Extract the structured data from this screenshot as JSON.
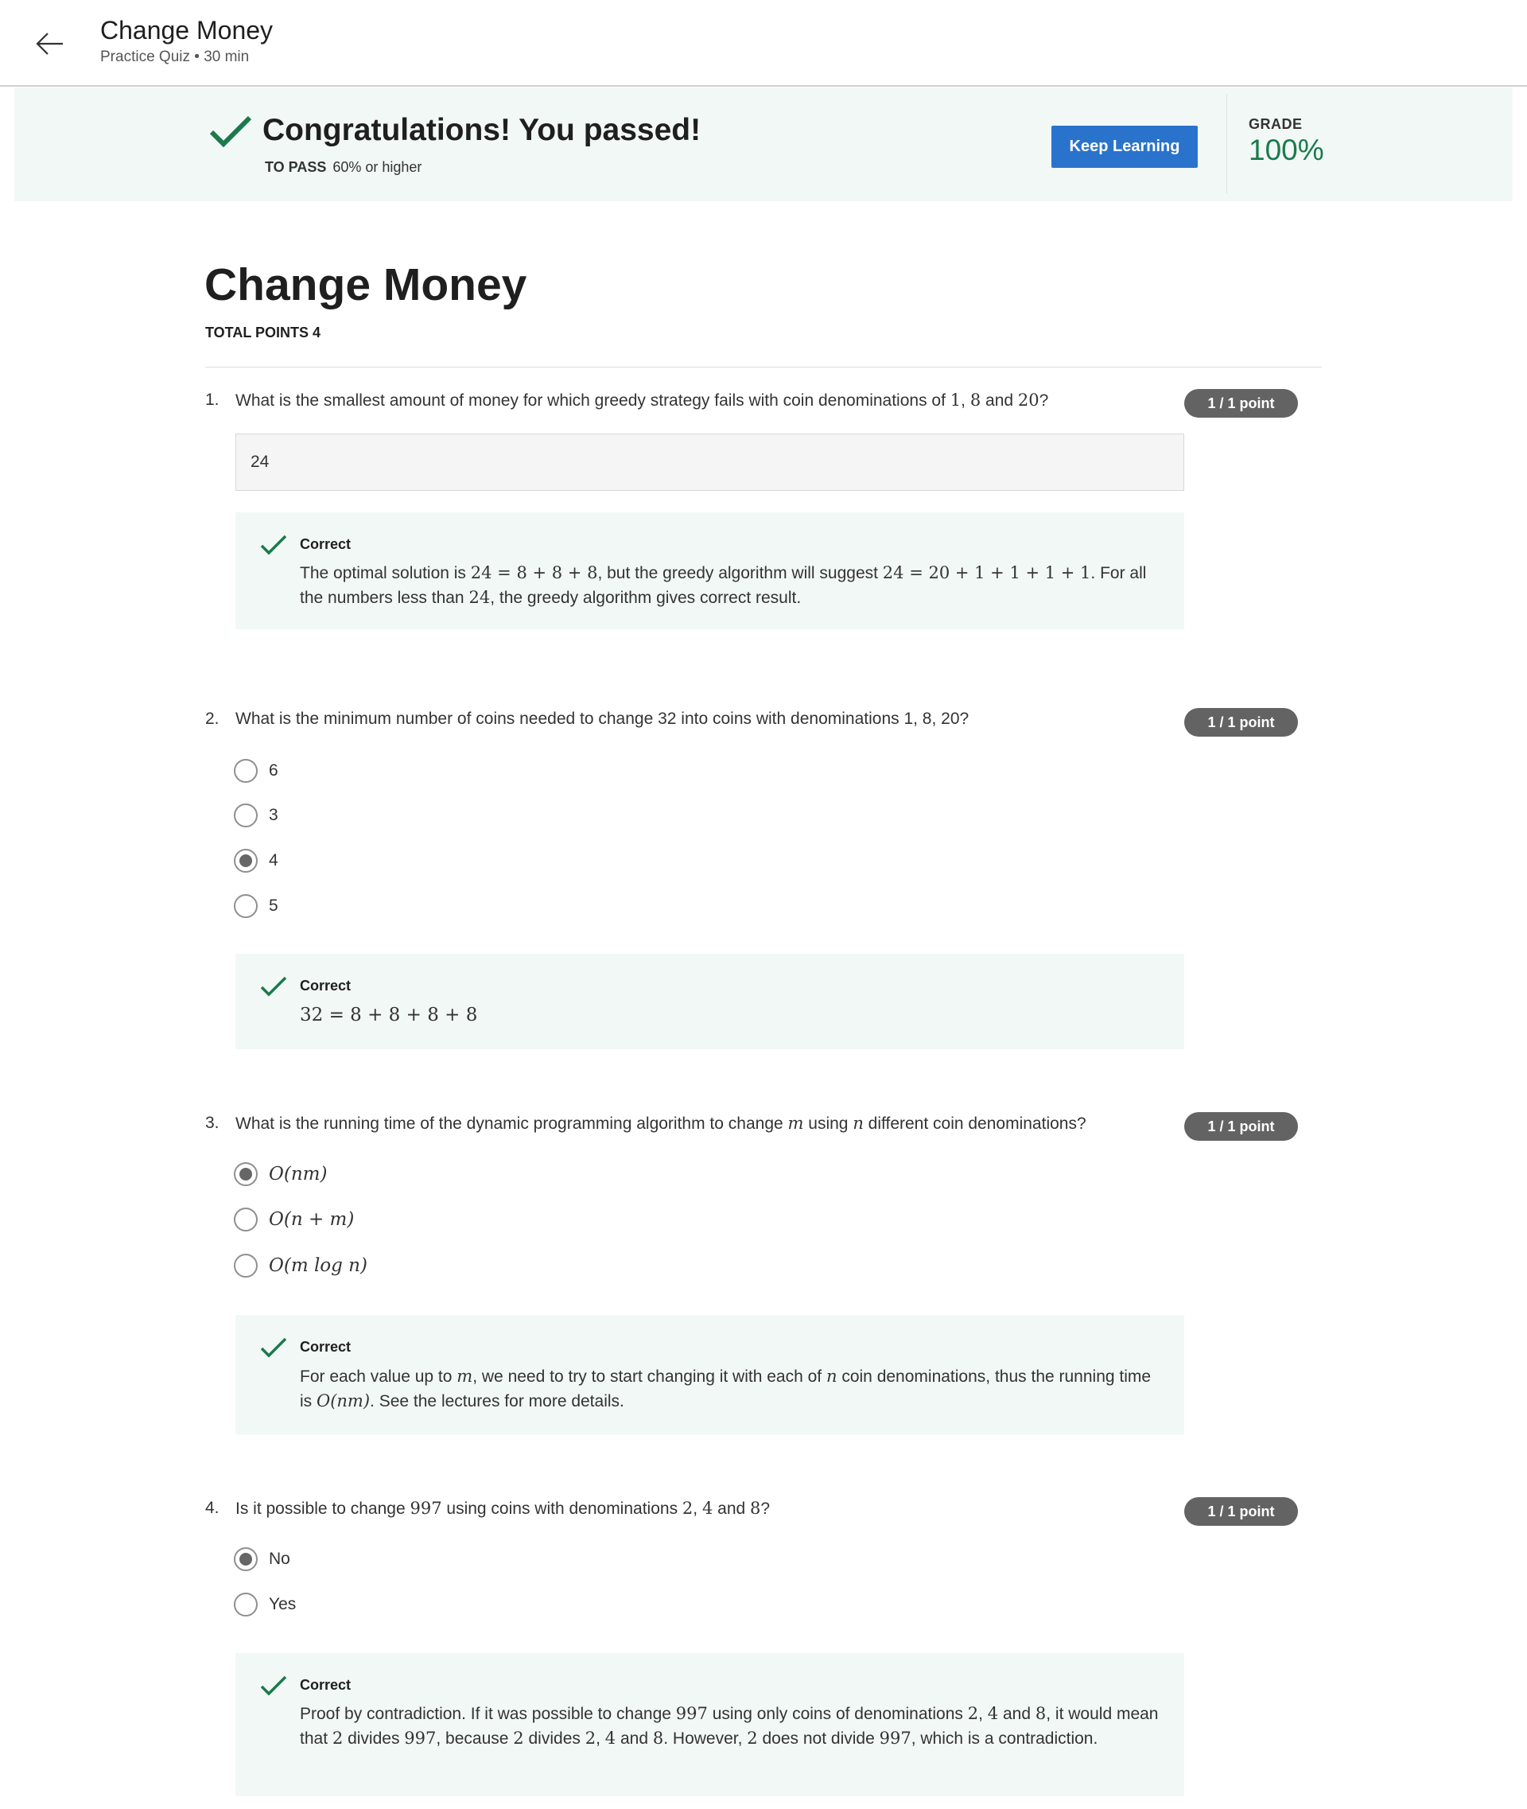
{
  "header": {
    "title": "Change Money",
    "subtitle": "Practice Quiz • 30 min"
  },
  "banner": {
    "title": "Congratulations! You passed!",
    "to_pass_label": "TO PASS",
    "to_pass_value": "60% or higher",
    "keep_learning": "Keep Learning",
    "grade_label": "GRADE",
    "grade_value": "100%"
  },
  "quiz": {
    "title": "Change Money",
    "total_points": "TOTAL POINTS 4"
  },
  "colors": {
    "accent": "#2a73cc",
    "success": "#1b7a4c",
    "badge": "#636363",
    "feedback_bg": "#f2f8f6"
  },
  "questions": [
    {
      "num": "1.",
      "points": "1 / 1 point",
      "text_before": "What is the smallest amount of money for which greedy strategy fails with coin denominations of ",
      "m1": "1",
      "sep1": ", ",
      "m2": "8",
      "sep2": " and ",
      "m3": "20",
      "text_after": "?",
      "answer": "24",
      "feedback_label": "Correct",
      "fb_t1": "The optimal solution is ",
      "fb_m1": "24 = 8 + 8 + 8",
      "fb_t2": ", but the greedy algorithm will suggest ",
      "fb_m2": "24 = 20 + 1 + 1 + 1 + 1",
      "fb_t3": ". For all the numbers less than ",
      "fb_m3": "24",
      "fb_t4": ", the greedy algorithm gives correct result."
    },
    {
      "num": "2.",
      "points": "1 / 1 point",
      "text": "What is the minimum number of coins needed to change 32 into coins with denominations 1, 8, 20?",
      "options": [
        "6",
        "3",
        "4",
        "5"
      ],
      "selected": "4",
      "feedback_label": "Correct",
      "fb_math": "32 = 8 + 8 + 8 + 8"
    },
    {
      "num": "3.",
      "points": "1 / 1 point",
      "text_before": "What is the running time of the dynamic programming algorithm to change ",
      "m1": "m",
      "text_mid": " using ",
      "m2": "n",
      "text_after": " different coin denominations?",
      "options": [
        "O(nm)",
        "O(n + m)",
        "O(m log n)"
      ],
      "selected": "O(nm)",
      "feedback_label": "Correct",
      "fb_t1": "For each value up to ",
      "fb_m1": "m",
      "fb_t2": ", we need to try to start changing it with each of ",
      "fb_m2": "n",
      "fb_t3": " coin denominations, thus the running time is ",
      "fb_m3": "O(nm)",
      "fb_t4": ". See the lectures for more details."
    },
    {
      "num": "4.",
      "points": "1 / 1 point",
      "text_before": "Is it possible to change ",
      "m1": "997",
      "text_mid": " using coins with denominations ",
      "m2": "2",
      "sep1": ", ",
      "m3": "4",
      "sep2": " and ",
      "m4": "8",
      "text_after": "?",
      "options": [
        "No",
        "Yes"
      ],
      "selected": "No",
      "feedback_label": "Correct",
      "fb_t1": "Proof by contradiction. If it was possible to change ",
      "fb_m1": "997",
      "fb_t2": " using only coins of denominations ",
      "fb_m2": "2",
      "fb_s1": ", ",
      "fb_m3": "4",
      "fb_s2": " and ",
      "fb_m4": "8",
      "fb_t3": ", it would mean that ",
      "fb_m5": "2",
      "fb_t4": " divides ",
      "fb_m6": "997",
      "fb_t5": ", because ",
      "fb_m7": "2",
      "fb_t6": " divides ",
      "fb_m8": "2",
      "fb_s3": ", ",
      "fb_m9": "4",
      "fb_s4": " and ",
      "fb_m10": "8",
      "fb_t7": ". However, ",
      "fb_m11": "2",
      "fb_t8": " does not divide ",
      "fb_m12": "997",
      "fb_t9": ", which is a contradiction."
    }
  ]
}
